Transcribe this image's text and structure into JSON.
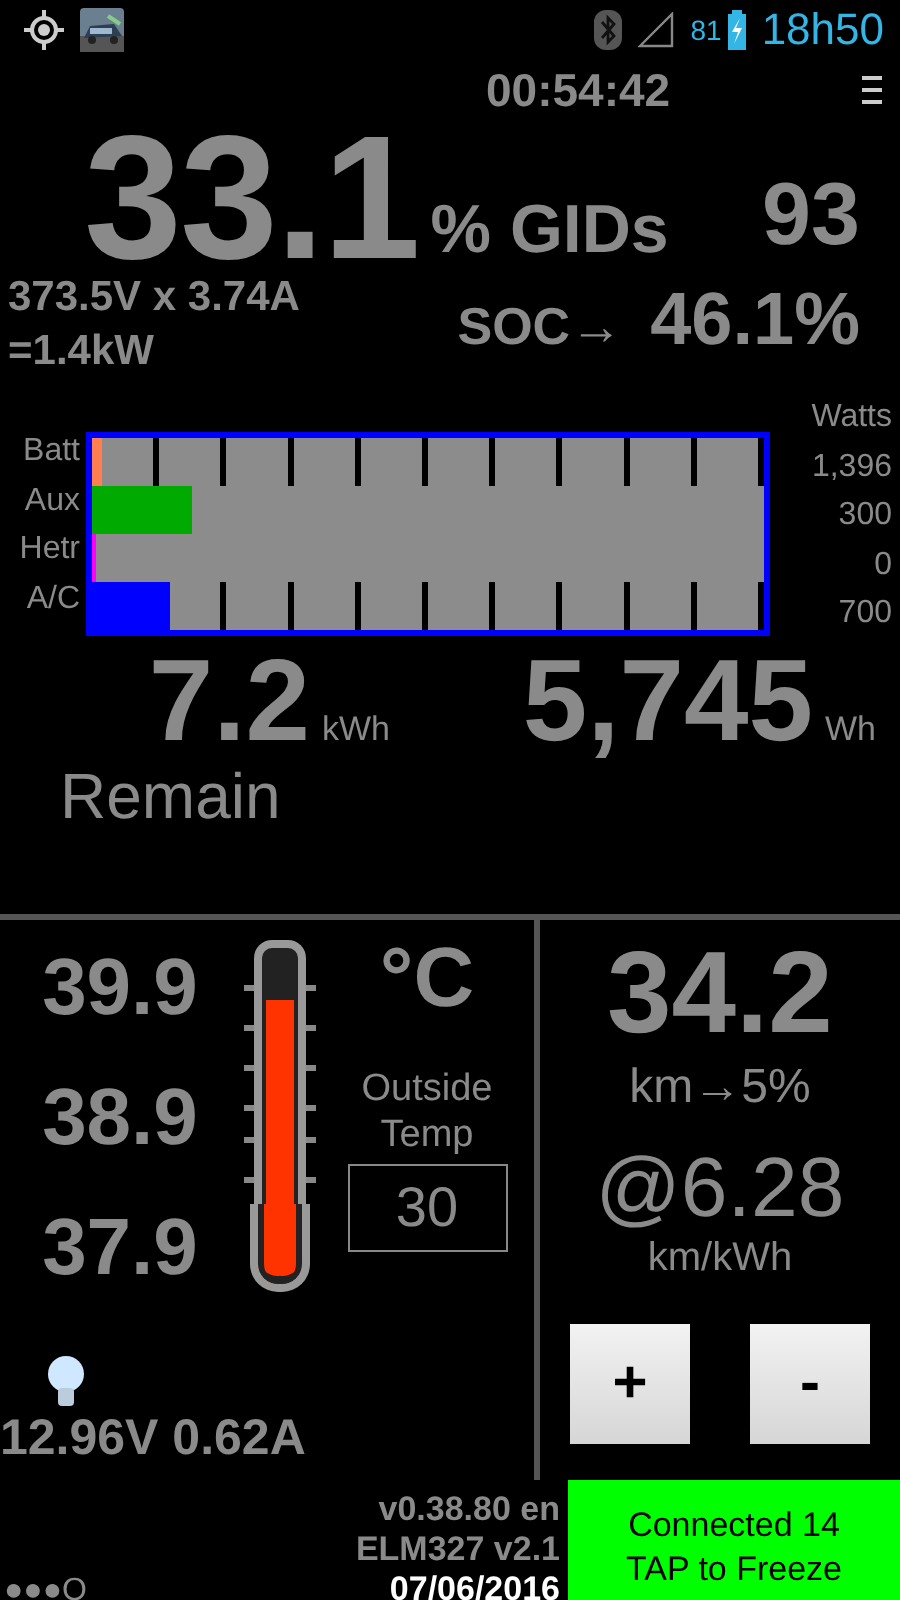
{
  "status_bar": {
    "battery_percent": "81",
    "time": "18h50"
  },
  "timer": "00:54:42",
  "gids": {
    "percent": "33.1",
    "label": "% GIDs",
    "count": "93"
  },
  "pack": {
    "power_line": "373.5V x 3.74A",
    "power_total": "=1.4kW"
  },
  "soc": {
    "label": "SOC→",
    "value": "46.1%"
  },
  "power_bars": {
    "unit_label": "Watts",
    "rows": [
      {
        "label": "Batt",
        "reading": "1,396",
        "level": 0.015,
        "color": "#ff7f50"
      },
      {
        "label": "Aux",
        "reading": "300",
        "level": 0.148,
        "color": "#00aa00"
      },
      {
        "label": "Hetr",
        "reading": "0",
        "level": 0.006,
        "color": "#ff00ff"
      },
      {
        "label": "A/C",
        "reading": "700",
        "level": 0.115,
        "color": "#0000ff"
      }
    ]
  },
  "energy": {
    "remain_value": "7.2",
    "remain_unit": "kWh",
    "remain_label": "Remain",
    "wh_value": "5,745",
    "wh_unit": "Wh"
  },
  "temperatures": {
    "readings": [
      "39.9",
      "38.9",
      "37.9"
    ],
    "level": 0.8,
    "unit": "°C",
    "outside_label": "Outside Temp",
    "outside_value": "30"
  },
  "aux_battery": "12.96V 0.62A",
  "range": {
    "value": "34.2",
    "label": "km→5%",
    "efficiency": "@6.28",
    "efficiency_unit": "km/kWh",
    "buttons": [
      "+",
      "-"
    ]
  },
  "footer": {
    "page_dots": "●●●O",
    "version": "v0.38.80 en",
    "adapter": "ELM327 v2.1",
    "date": "07/06/2016",
    "connection": [
      "Connected 14",
      "TAP to Freeze"
    ]
  }
}
